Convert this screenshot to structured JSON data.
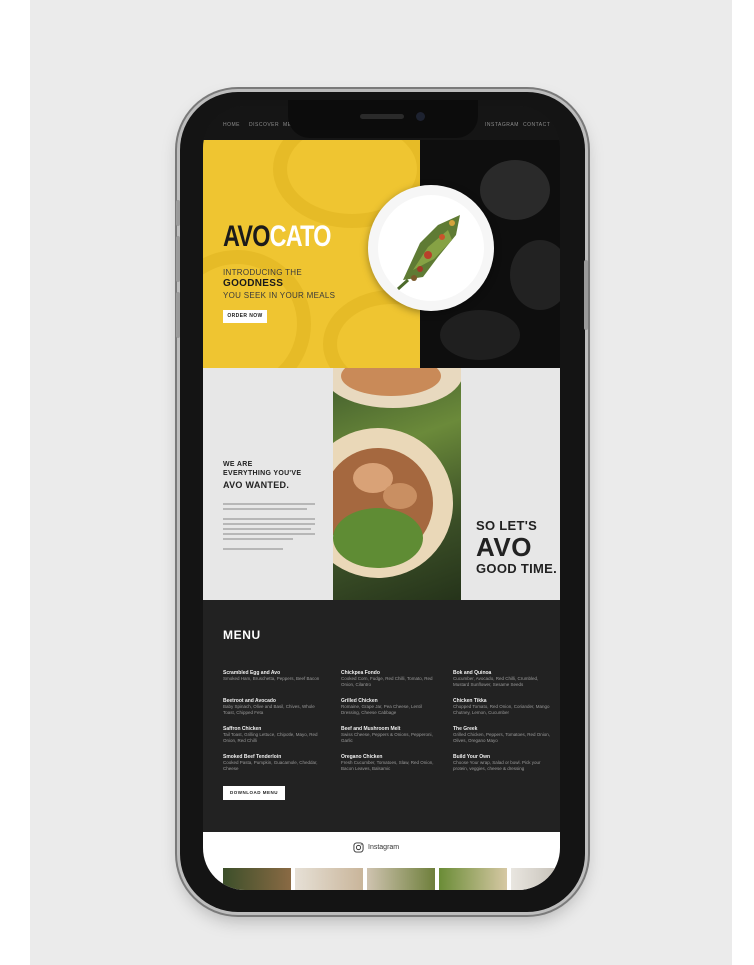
{
  "nav": {
    "items": [
      "Home",
      "Discover",
      "Menu",
      "Instagram",
      "Contact"
    ]
  },
  "hero": {
    "logo_part1": "AVO",
    "logo_part2": "CATO",
    "line1": "INTRODUCING THE",
    "line2": "GOODNESS",
    "line3": "YOU SEEK IN YOUR MEALS",
    "cta": "ORDER NOW",
    "colors": {
      "yellow": "#efc531",
      "dark": "#0e0e0e"
    }
  },
  "about": {
    "heading_small": "WE ARE\nEVERYTHING YOU'VE",
    "heading_bold": "AVO WANTED.",
    "slogan1": "SO LET'S",
    "slogan2": "AVO",
    "slogan3": "GOOD TIME."
  },
  "menu": {
    "title": "MENU",
    "columns": [
      [
        {
          "name": "Scrambled Egg and Avo",
          "desc": "Smoked Ham, Bruschetta, Peppers, Beef Bacon"
        },
        {
          "name": "Beetroot and Avocado",
          "desc": "Baby Spinach, Olive and Basil, Chives, Whole Toast, Chipped Feta"
        },
        {
          "name": "Saffron Chicken",
          "desc": "Tail Toast, Grilling Lettuce, Chipotle, Mayo, Red Onion, Red Chilli"
        },
        {
          "name": "Smoked Beef Tenderloin",
          "desc": "Cooked Pasta, Pumpkin, Guacamole, Cheddar, Cheese"
        }
      ],
      [
        {
          "name": "Chickpea Fondo",
          "desc": "Cooked Corn, Fudge, Red Chilli, Tomato, Red Onion, Cilantro"
        },
        {
          "name": "Grilled Chicken",
          "desc": "Romaine, Grape Jar, Pea Cheese, Lentil Dressing, Cheese Cabbage"
        },
        {
          "name": "Beef and Mushroom Melt",
          "desc": "Swiss Cheese, Peppers & Onions, Pepperoni, Garlic"
        },
        {
          "name": "Oregano Chicken",
          "desc": "Fresh Cucumber, Tomatoes, Slaw, Red Onion, Bacon Leaves, Balsamic"
        }
      ],
      [
        {
          "name": "Bok and Quinoa",
          "desc": "Cucumber, Avocado, Red Chilli, Crumbled, Mustard Sunflower, Sesame Seeds"
        },
        {
          "name": "Chicken Tikka",
          "desc": "Chopped Tomato, Red Onion, Coriander, Mango Chutney, Lemon, Cucumber"
        },
        {
          "name": "The Greek",
          "desc": "Grilled Chicken, Peppers, Tomatoes, Red Onion, Olives, Oregano Mayo"
        },
        {
          "name": "Build Your Own",
          "desc": "Choose Your wrap, Salad or bowl. Pick your protein, veggies, cheese & dressing"
        }
      ]
    ],
    "cta": "DOWNLOAD MENU"
  },
  "instagram": {
    "label": "Instagram"
  }
}
